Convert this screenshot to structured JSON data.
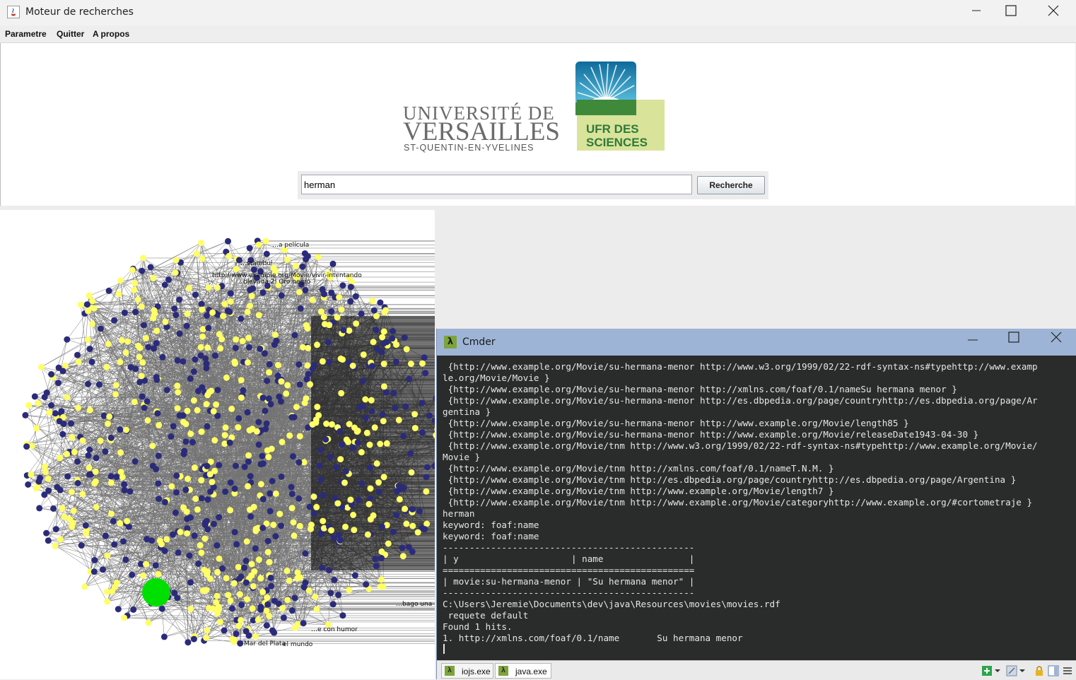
{
  "app": {
    "title": "Moteur de recherches",
    "menu": [
      "Parametre",
      "Quitter",
      "A propos"
    ]
  },
  "logo": {
    "line1": "UNIVERSITÉ DE",
    "line2": "VERSAILLES",
    "line3": "ST-QUENTIN-EN-YVELINES",
    "badge_line1": "UFR DES",
    "badge_line2": "SCIENCES"
  },
  "search": {
    "value": "herman",
    "button_label": "Recherche"
  },
  "graph": {
    "visible_labels": [
      "…a película",
      "…stambul",
      "http://www.example.org/Movie/vivir-intentando",
      "…blevada 2: Oro negro",
      "Mar del Plata",
      "…bago una p",
      "…e con humor",
      "el mundo"
    ],
    "highlight_color": "#00e000",
    "node_color_a": "#2b2b7a",
    "node_color_b": "#ffff66"
  },
  "cmder": {
    "title": "Cmder",
    "lines": [
      " {http://www.example.org/Movie/su-hermana-menor http://www.w3.org/1999/02/22-rdf-syntax-ns#typehttp://www.examp",
      "le.org/Movie/Movie }",
      " {http://www.example.org/Movie/su-hermana-menor http://xmlns.com/foaf/0.1/nameSu hermana menor }",
      " {http://www.example.org/Movie/su-hermana-menor http://es.dbpedia.org/page/countryhttp://es.dbpedia.org/page/Ar",
      "gentina }",
      " {http://www.example.org/Movie/su-hermana-menor http://www.example.org/Movie/length85 }",
      " {http://www.example.org/Movie/su-hermana-menor http://www.example.org/Movie/releaseDate1943-04-30 }",
      " {http://www.example.org/Movie/tnm http://www.w3.org/1999/02/22-rdf-syntax-ns#typehttp://www.example.org/Movie/",
      "Movie }",
      " {http://www.example.org/Movie/tnm http://xmlns.com/foaf/0.1/nameT.N.M. }",
      " {http://www.example.org/Movie/tnm http://es.dbpedia.org/page/countryhttp://es.dbpedia.org/page/Argentina }",
      " {http://www.example.org/Movie/tnm http://www.example.org/Movie/length7 }",
      " {http://www.example.org/Movie/tnm http://www.example.org/Movie/categoryhttp://www.example.org/#cortometraje }",
      "herman",
      "keyword: foaf:name",
      "keyword: foaf:name",
      "-----------------------------------------------",
      "| y                     | name                |",
      "===============================================",
      "| movie:su-hermana-menor | \"Su hermana menor\" |",
      "-----------------------------------------------",
      "C:\\Users\\Jeremie\\Documents\\dev\\java\\Resources\\movies\\movies.rdf",
      " requete default",
      "Found 1 hits.",
      "1. http://xmlns.com/foaf/0.1/name       Su hermana menor"
    ],
    "tabs": [
      "iojs.exe",
      "java.exe"
    ]
  }
}
